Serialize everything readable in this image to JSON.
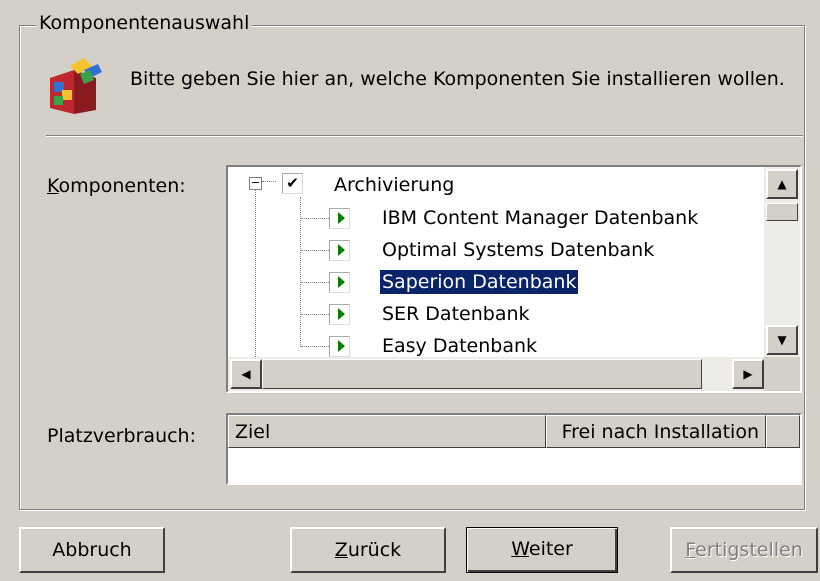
{
  "group": {
    "title": "Komponentenauswahl"
  },
  "header": {
    "description": "Bitte geben Sie hier an, welche Komponenten Sie installieren wollen."
  },
  "components": {
    "label_underlined": "K",
    "label_rest": "omponenten:",
    "tree": {
      "root": {
        "label": "Archivierung",
        "checked": true,
        "expander": "−"
      },
      "items": [
        {
          "label": "IBM Content Manager Datenbank",
          "selected": false
        },
        {
          "label": "Optimal Systems Datenbank",
          "selected": false
        },
        {
          "label": "Saperion Datenbank",
          "selected": true
        },
        {
          "label": "SER Datenbank",
          "selected": false
        },
        {
          "label": "Easy Datenbank",
          "selected": false
        }
      ]
    },
    "scroll_up": "▲",
    "scroll_down": "▼",
    "scroll_left": "◀",
    "scroll_right": "▶"
  },
  "space": {
    "label": "Platzverbrauch:",
    "columns": [
      "Ziel",
      "Frei nach Installation"
    ]
  },
  "buttons": {
    "cancel": "Abbruch",
    "back_underlined": "Z",
    "back_rest": "urück",
    "next_underlined": "W",
    "next_rest": "eiter",
    "finish_underlined": "F",
    "finish_rest": "ertigstellen"
  },
  "colors": {
    "dialog_bg": "#d4d0c8",
    "selection": "#0a246a",
    "arrow_green": "#008000"
  }
}
